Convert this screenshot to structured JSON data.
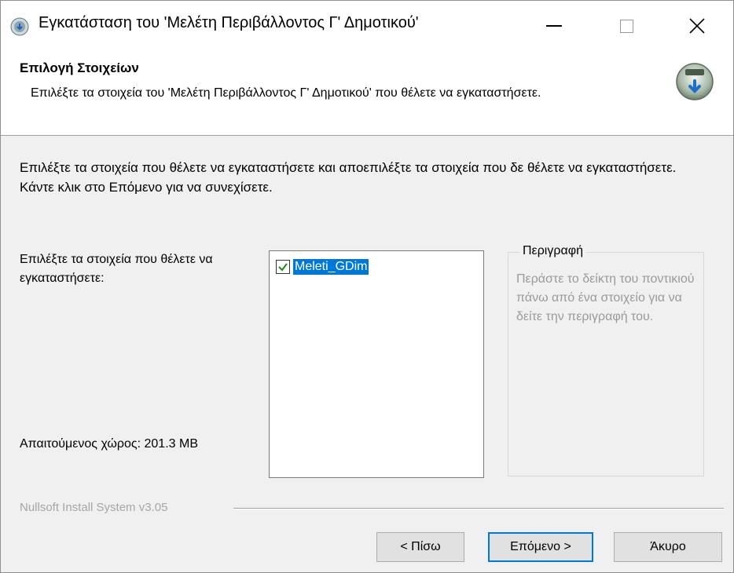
{
  "window": {
    "title": "Εγκατάσταση του 'Μελέτη Περιβάλλοντος Γ' Δημοτικού'",
    "min_icon": "minimize-icon",
    "max_icon": "maximize-icon",
    "close_icon": "close-icon",
    "close_glyph": "✕"
  },
  "header": {
    "title": "Επιλογή Στοιχείων",
    "subtitle": "Επιλέξτε τα στοιχεία του 'Μελέτη Περιβάλλοντος Γ' Δημοτικού' που θέλετε να εγκαταστήσετε.",
    "icon": "installer-disk-icon"
  },
  "body": {
    "intro": "Επιλέξτε τα στοιχεία που θέλετε να εγκαταστήσετε και αποεπιλέξτε τα στοιχεία που δε θέλετε να εγκαταστήσετε. Κάντε κλικ στο Επόμενο για να συνεχίσετε.",
    "select_label": "Επιλέξτε τα στοιχεία που θέλετε να εγκαταστήσετε:",
    "space_label": "Απαιτούμενος χώρος: 201.3 MB",
    "components": [
      {
        "label": "Meleti_GDim",
        "checked": true
      }
    ],
    "description_title": "Περιγραφή",
    "description_text": "Περάστε το δείκτη του ποντικιού πάνω από ένα στοιχείο για να δείτε την περιγραφή του."
  },
  "footer": {
    "brand": "Nullsoft Install System v3.05",
    "back_label": "< Πίσω",
    "next_label": "Επόμενο >",
    "cancel_label": "Άκυρο"
  },
  "colors": {
    "accent": "#0078d7",
    "check": "#1a8a1a"
  }
}
